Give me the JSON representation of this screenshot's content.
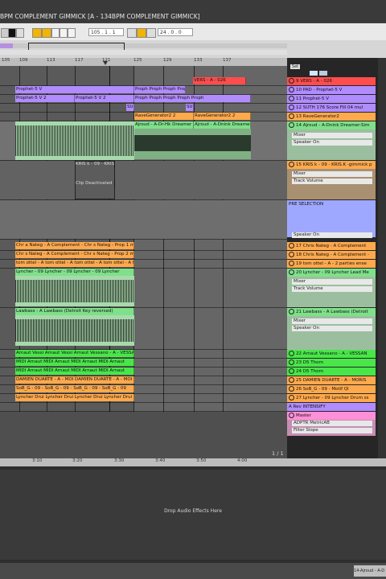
{
  "window": {
    "title": "BPM COMPLEMENT GIMMICK  [A - 134BPM COMPLEMENT GIMMICK]"
  },
  "transport": {
    "tempo": "105 . 1 . 1",
    "position": "24 . 0 . 0"
  },
  "ruler": {
    "bars": [
      "105",
      "109",
      "113",
      "117",
      "121",
      "125",
      "129",
      "133",
      "137"
    ]
  },
  "time_ruler": {
    "labels": [
      "3:10",
      "3:20",
      "3:30",
      "3:40",
      "3:50",
      "4:00"
    ]
  },
  "arrangement": {
    "clips": {
      "c_rec": "VERS - A - 026",
      "c_pro1": "Prophet-5 V",
      "c_pro2": "Prophet-5 V 2",
      "c_pro3": "Prophet-5 V 2",
      "c_pro4": "Proph Proph Proph Proph Proph",
      "c_pro5": "Proph Proph Proph Proph Proph",
      "c_su1": "SU",
      "c_su2": "SU",
      "c_rave1": "RaveGenerator2 2",
      "c_rave2": "RaveGenerator2 2",
      "c_ajr1": "Ajroud - A-Dr-Hk Dreamer",
      "c_ajr2": "Ajroud - A-Dnink Dreamer",
      "c_kris": "KRIS k - 09 - KRIS",
      "c_deact": "Clip Deactivated",
      "c_chr1": "Chr a Nateg - A Complement - Chr s Nateg - Prop 1 m",
      "c_chr2": "Chr s Nateg - A Complement - Chr s Nateg - Prop 2 m",
      "c_tom": "tom ottel - A tom ottel - A tom ottel - A tom ottel - A t",
      "c_lyn": "Lyncher - 09 Lyncher - 09 Lyncher - 09 Lyncher",
      "c_law": "Lawbass - A Lawbass (Detroit Key reversed)",
      "c_arn1": "Arnaut Vessi Arnaut Vessi Arnaut Vessano - A - VESSA",
      "c_arn2": "MIDI Arnaut  MIDI Arnaut  MIDI Arnaut  MIDI Arnaut",
      "c_arn3": "MIDI Arnaut  MIDI Arnaut  MIDI Arnaut  MIDI Arnaut",
      "c_dam": "DAMIEN DUARTE - A - MOI DAMIEN DUARTE - A - MOI",
      "c_sob": "SoB_G - 09 - SoB_G - 09 - SoB_G - 09 - SoB_G - 09",
      "c_lyn2": "Lyncher Drui Lyncher Drui Lyncher Drui Lyncher Drui"
    },
    "page_indicator": "1 / 1"
  },
  "tracks": {
    "set_label": "Set",
    "items": [
      {
        "label": "9 VERS - A - 026",
        "color": "#ff4d4d"
      },
      {
        "label": "10 PAD - Prophet-5 V",
        "color": "#b18cff"
      },
      {
        "label": "11 Prophet-5 V",
        "color": "#b18cff"
      },
      {
        "label": "12 SUTH 176 Score Fill 04 mul",
        "color": "#b18cff"
      },
      {
        "label": "13 RaveGenerator2",
        "color": "#ffa94d"
      },
      {
        "label": "14 Ajroud - A-Dnink Dreamer-Sim",
        "color": "#7fe08a"
      },
      {
        "label": "15 KRIS k - 09 - KRIS.K -gimmick p",
        "color": "#ffa94d"
      },
      {
        "label": "PRE SELECTION",
        "color": "#9ea8ff"
      },
      {
        "label": "17 Chris Nateg - A Complement",
        "color": "#ffa94d"
      },
      {
        "label": "18 Chris Nateg - A Complement -",
        "color": "#ffa94d"
      },
      {
        "label": "19 tom ottel - A - 2 parties ense",
        "color": "#ffa94d"
      },
      {
        "label": "20 Lyncher - 09 Lyncher Lead Me",
        "color": "#7fe08a"
      },
      {
        "label": "21 Lawbass - A Lawbass (Detroit",
        "color": "#7fe08a"
      },
      {
        "label": "22 Arnaut Vessano - A - VESSAN",
        "color": "#49e649"
      },
      {
        "label": "23 D5 Thorn",
        "color": "#49e649"
      },
      {
        "label": "24 D5 Thorn",
        "color": "#49e649"
      },
      {
        "label": "25 DAMIEN DUARTE - A - MORIS",
        "color": "#ffa94d"
      },
      {
        "label": "26 SoB_G - 09 - Motif Ql",
        "color": "#ffa94d"
      },
      {
        "label": "27 Lyncher - 09 Lyncher Drum ss",
        "color": "#ffa94d"
      },
      {
        "label": "A Rev INTENSIFY",
        "color": "#b18cff"
      },
      {
        "label": "Master",
        "color": "#ff8fd6"
      }
    ],
    "devices": {
      "d1": "Mixer",
      "d2": "Speaker On",
      "d3": "Mixer",
      "d4": "Track Volume",
      "d5": "Speaker On",
      "d6": "Mixer",
      "d7": "Track Volume",
      "d8": "Mixer",
      "d9": "Speaker On",
      "d10": "ADPTR MetricAB",
      "d11": "Filter Slope"
    }
  },
  "detail": {
    "drop_hint": "Drop Audio Effects Here",
    "clip_name": "14-Ajroud - A-D"
  }
}
